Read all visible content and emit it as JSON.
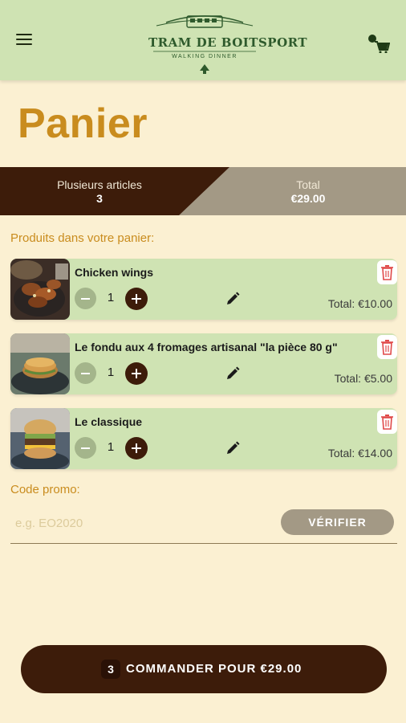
{
  "header": {
    "logo_title": "TRAM DE BOITSPORT",
    "logo_subtitle": "WALKING DINNER",
    "menu_icon": "hamburger-menu-icon",
    "cart_icon": "cart-icon"
  },
  "page": {
    "title": "Panier"
  },
  "summary": {
    "items_label": "Plusieurs articles",
    "items_count": "3",
    "total_label": "Total",
    "total_value": "€29.00"
  },
  "products_label": "Produits dans votre panier:",
  "products": [
    {
      "name": "Chicken wings",
      "quantity": "1",
      "total": "Total: €10.00"
    },
    {
      "name": "Le fondu aux 4 fromages artisanal \"la pièce 80 g\"",
      "quantity": "1",
      "total": "Total: €5.00"
    },
    {
      "name": "Le classique",
      "quantity": "1",
      "total": "Total: €14.00"
    }
  ],
  "promo": {
    "label": "Code promo:",
    "placeholder": "e.g. EO2020",
    "verify_label": "VÉRIFIER"
  },
  "order": {
    "count": "3",
    "label": "COMMANDER POUR €29.00"
  },
  "colors": {
    "header_bg": "#cfe3b3",
    "page_bg": "#fbf0d2",
    "accent_brown": "#3d1c0a",
    "accent_gold": "#c98c1e",
    "muted_taupe": "#a39985",
    "delete_red": "#e04848"
  }
}
